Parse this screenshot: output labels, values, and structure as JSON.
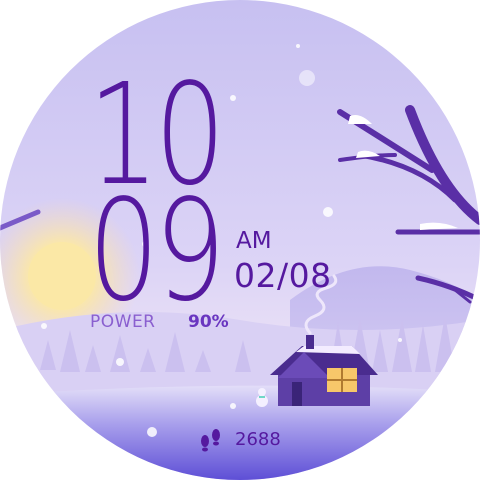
{
  "time": {
    "hour": "10",
    "minute": "09",
    "ampm": "AM"
  },
  "date": "02/08",
  "power": {
    "label": "POWER",
    "value": "90%"
  },
  "steps": {
    "icon": "footsteps-icon",
    "value": "2688"
  },
  "colors": {
    "digits": "#55199f",
    "sky_top": "#c9c2f2",
    "sky_bottom": "#e6dcf5",
    "ground": "#7a6ae0"
  }
}
